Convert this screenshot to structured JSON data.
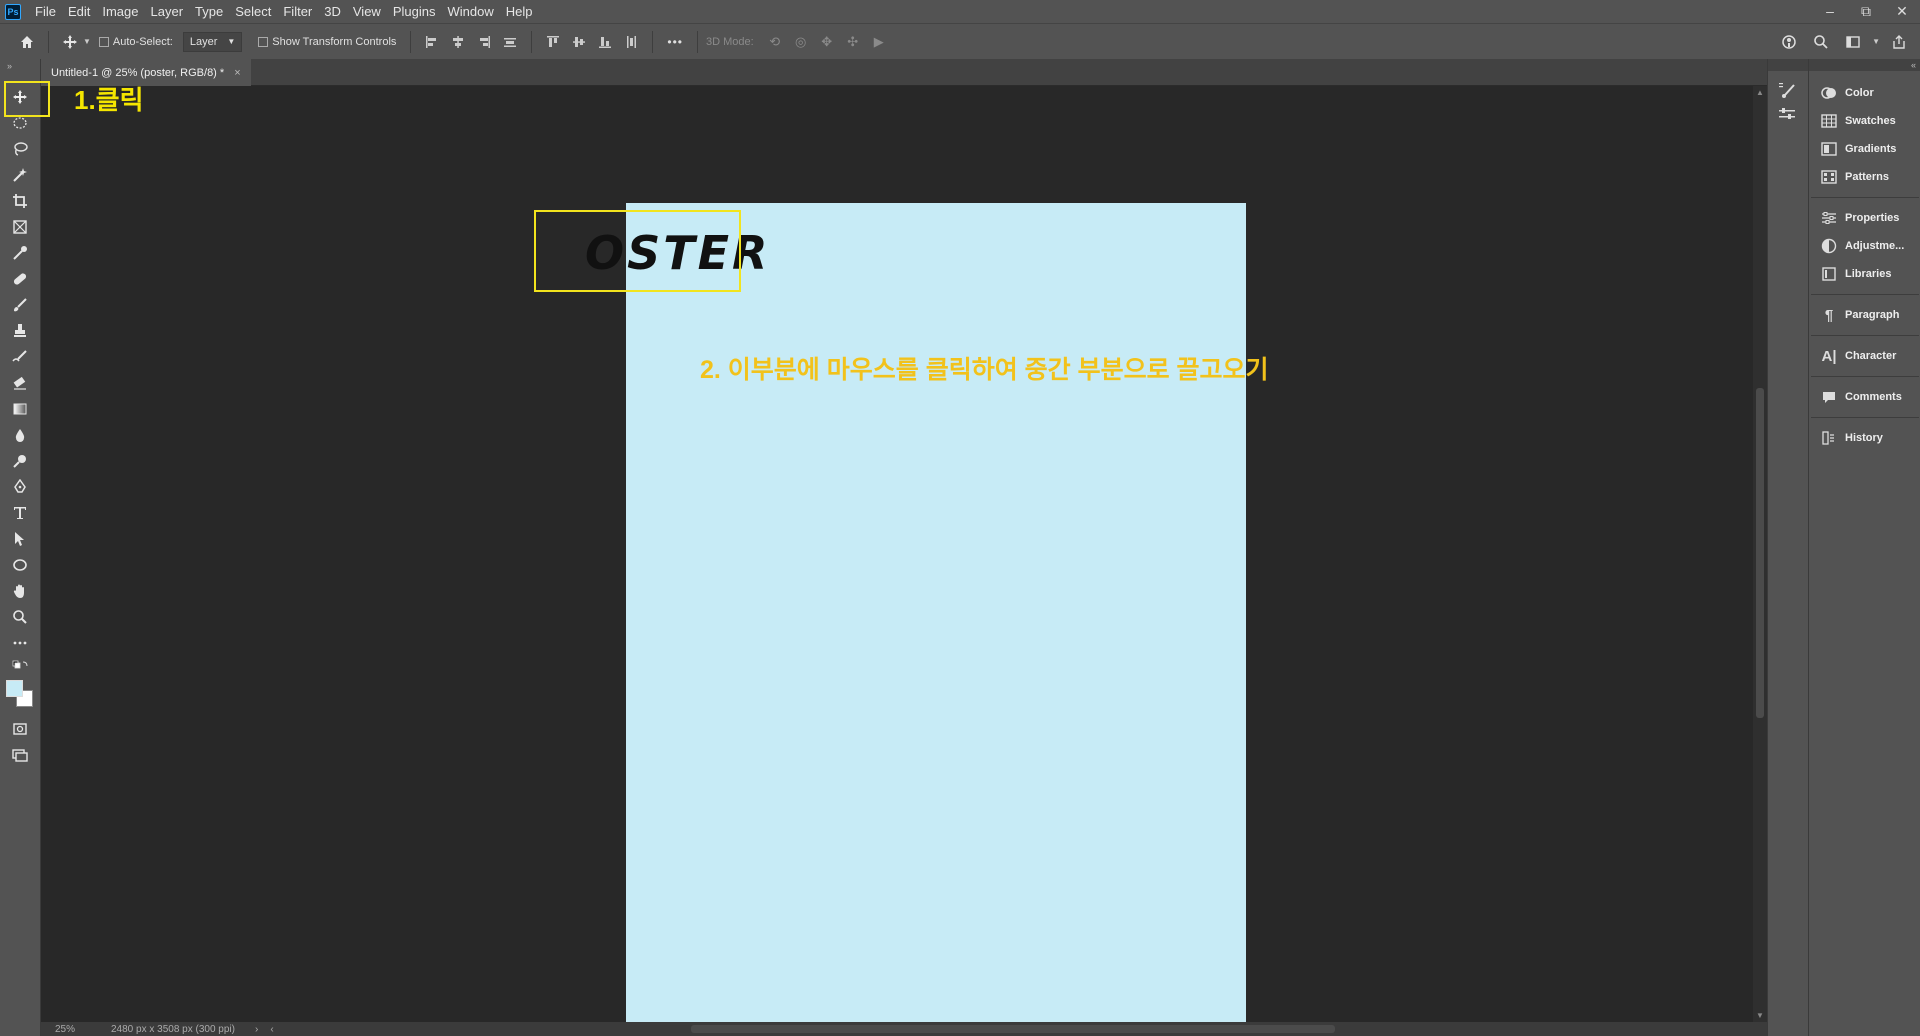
{
  "app": {
    "logo": "Ps"
  },
  "menu": [
    "File",
    "Edit",
    "Image",
    "Layer",
    "Type",
    "Select",
    "Filter",
    "3D",
    "View",
    "Plugins",
    "Window",
    "Help"
  ],
  "window_controls": {
    "minimize": "–",
    "restore": "⧉",
    "close": "✕"
  },
  "options_bar": {
    "auto_select_label": "Auto-Select:",
    "auto_select_value": "Layer",
    "show_transform_label": "Show Transform Controls",
    "more": "•••",
    "mode_label": "3D Mode:"
  },
  "document": {
    "tab_title": "Untitled-1 @ 25% (poster, RGB/8) *",
    "tab_close": "×",
    "canvas_color": "#c7ebf6",
    "poster_text": "OSTER"
  },
  "annotations": {
    "step1": "1.클릭",
    "step2": "2. 이부분에 마우스를 클릭하여 중간 부분으로 끌고오기",
    "highlight_color": "#f2e41d"
  },
  "status": {
    "zoom": "25%",
    "dimensions": "2480 px x 3508 px (300 ppi)",
    "arrow": "›",
    "left_arrow": "‹"
  },
  "right_panels": [
    {
      "label": "Color",
      "icon": "color-wheel-icon"
    },
    {
      "label": "Swatches",
      "icon": "swatches-grid-icon"
    },
    {
      "label": "Gradients",
      "icon": "gradient-icon"
    },
    {
      "label": "Patterns",
      "icon": "patterns-grid-icon"
    },
    {
      "label": "Properties",
      "icon": "sliders-icon"
    },
    {
      "label": "Adjustme...",
      "icon": "adjustment-circle-icon"
    },
    {
      "label": "Libraries",
      "icon": "libraries-icon"
    },
    {
      "label": "Paragraph",
      "icon": "pilcrow-icon"
    },
    {
      "label": "Character",
      "icon": "character-icon"
    },
    {
      "label": "Comments",
      "icon": "speech-bubble-icon"
    },
    {
      "label": "History",
      "icon": "history-icon"
    }
  ]
}
